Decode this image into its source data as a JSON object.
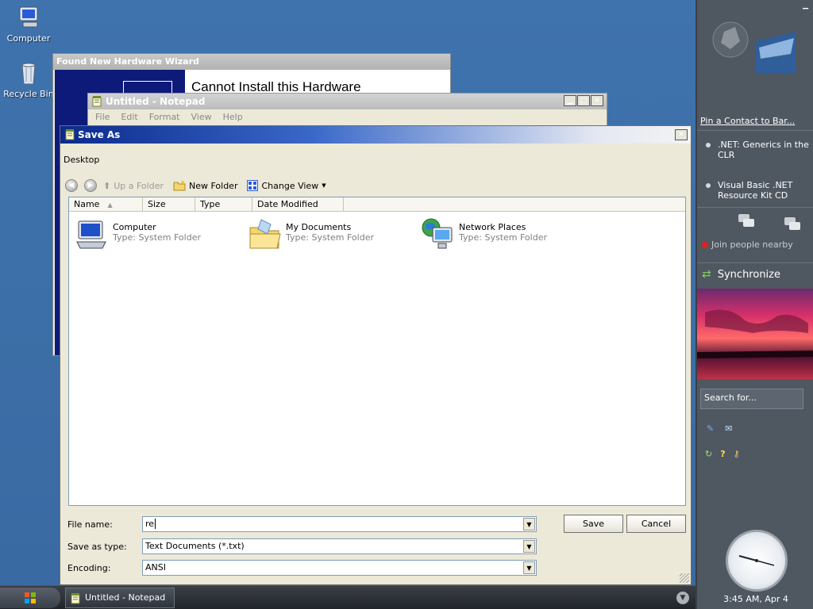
{
  "desktop": {
    "icons": [
      {
        "label": "Computer"
      },
      {
        "label": "Recycle Bin"
      }
    ]
  },
  "hardware_wizard": {
    "title": "Found New Hardware Wizard",
    "heading": "Cannot Install this Hardware"
  },
  "notepad": {
    "title": "Untitled - Notepad",
    "menu": [
      "File",
      "Edit",
      "Format",
      "View",
      "Help"
    ]
  },
  "save_as": {
    "title": "Save As",
    "location": "Desktop",
    "toolbar": {
      "up_folder": "Up a Folder",
      "new_folder": "New Folder",
      "change_view": "Change View"
    },
    "columns": [
      "Name",
      "Size",
      "Type",
      "Date Modified"
    ],
    "items": [
      {
        "name": "Computer",
        "type": "Type: System Folder",
        "icon": "computer-icon"
      },
      {
        "name": "My Documents",
        "type": "Type: System Folder",
        "icon": "folder-icon"
      },
      {
        "name": "Network Places",
        "type": "Type: System Folder",
        "icon": "network-icon"
      }
    ],
    "file_name_label": "File name:",
    "file_name_value": "re",
    "save_type_label": "Save as type:",
    "save_type_value": "Text Documents (*.txt)",
    "encoding_label": "Encoding:",
    "encoding_value": "ANSI",
    "save_button": "Save",
    "cancel_button": "Cancel"
  },
  "sidebar": {
    "pin_contact": "Pin a Contact to Bar...",
    "items": [
      ".NET: Generics in the CLR",
      "Visual Basic .NET Resource Kit CD"
    ],
    "join_people": "Join people nearby",
    "synchronize": "Synchronize",
    "search_placeholder": "Search for...",
    "clock_time": "3:45 AM, Apr 4"
  },
  "taskbar": {
    "task_label": "Untitled - Notepad"
  },
  "colors": {
    "title_active": "#0b2a8c",
    "desktop": "#3b6ea5",
    "sidebar": "#4f5761"
  }
}
